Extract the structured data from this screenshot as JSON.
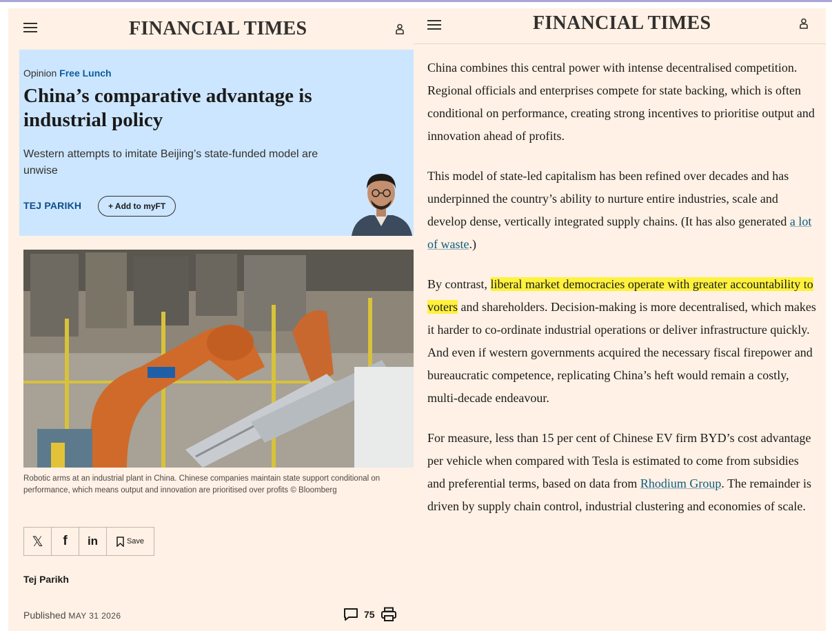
{
  "masthead": "FINANCIAL TIMES",
  "hero": {
    "section": "Opinion",
    "series": "Free Lunch",
    "headline": "China’s comparative advantage is industrial policy",
    "standfirst": "Western attempts to imitate Beijing’s state-funded model are unwise",
    "author": "TEJ PARIKH",
    "add_button": "+ Add to myFT"
  },
  "caption": "Robotic arms at an industrial plant in China. Chinese companies maintain state support conditional on performance, which means output and innovation are prioritised over profits © Bloomberg",
  "share": {
    "x_label": "𝕏",
    "f_label": "f",
    "in_label": "in",
    "save_label": "Save"
  },
  "byline": "Tej Parikh",
  "published": {
    "label": "Published",
    "date": "MAY 31 2026"
  },
  "comments_count": "75",
  "article": {
    "p1": "China combines this central power with intense decentralised competition. Regional officials and enterprises compete for state backing, which is often conditional on performance, creating strong incentives to prioritise output and innovation ahead of profits.",
    "p2_before": "This model of state-led capitalism has been refined over decades and has underpinned the country’s ability to nurture entire industries, scale and develop dense, vertically integrated supply chains. (It has also generated ",
    "p2_link": "a lot of waste",
    "p2_after": ".)",
    "p3_before": "By contrast, ",
    "p3_highlight": "liberal market democracies operate with greater accountability to voters",
    "p3_after": " and shareholders. Decision-making is more decentralised, which makes it harder to co-ordinate industrial operations or deliver infrastructure quickly. And even if western governments acquired the necessary fiscal firepower and bureaucratic competence, replicating China’s heft would remain a costly, multi-decade endeavour.",
    "p4_before": "For measure, less than 15 per cent of Chinese EV firm BYD’s cost advantage per vehicle when compared with Tesla is estimated to come from subsidies and preferential terms, based on data from ",
    "p4_link": "Rhodium Group",
    "p4_after": ". The remainder is driven by supply chain control, industrial clustering and economies of scale."
  },
  "colors": {
    "paper": "#fff1e5",
    "hero_blue": "#cce6ff",
    "highlight": "#fff23d",
    "link": "#0d5b7f"
  }
}
